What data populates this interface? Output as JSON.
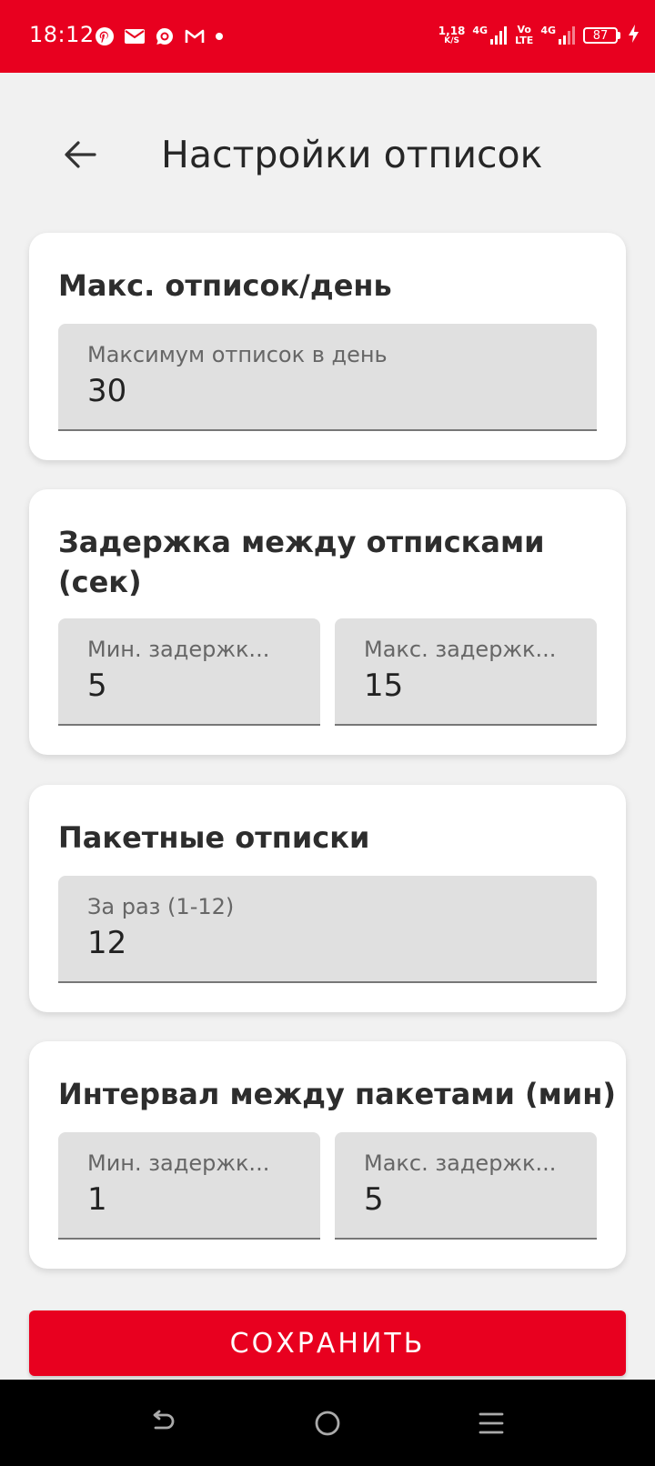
{
  "status_bar": {
    "time": "18:12",
    "net_speed_value": "1,18",
    "net_speed_unit": "K/S",
    "sim1_label": "4G",
    "volte_top": "Vo",
    "volte_bottom": "LTE",
    "sim2_label": "4G",
    "battery": "87",
    "notifications": [
      "pinterest-icon",
      "mail-icon",
      "messenger-icon",
      "gmail-icon",
      "dot-icon"
    ]
  },
  "header": {
    "title": "Настройки отписок"
  },
  "cards": {
    "max_per_day": {
      "title": "Макс. отписок/день",
      "field": {
        "label": "Максимум отписок в день",
        "value": "30"
      }
    },
    "delay": {
      "title": "Задержка между отписками (сек)",
      "min": {
        "label": "Мин. задержк...",
        "value": "5"
      },
      "max": {
        "label": "Макс. задержк...",
        "value": "15"
      }
    },
    "batch": {
      "title": "Пакетные отписки",
      "field": {
        "label": "За раз (1-12)",
        "value": "12"
      }
    },
    "interval": {
      "title": "Интервал между пакетами (мин)",
      "min": {
        "label": "Мин. задержк...",
        "value": "1"
      },
      "max": {
        "label": "Макс. задержк...",
        "value": "5"
      }
    }
  },
  "save_label": "СОХРАНИТЬ",
  "colors": {
    "accent": "#e8001f",
    "background": "#f1f1f1",
    "field_background": "#e0e0e0"
  }
}
